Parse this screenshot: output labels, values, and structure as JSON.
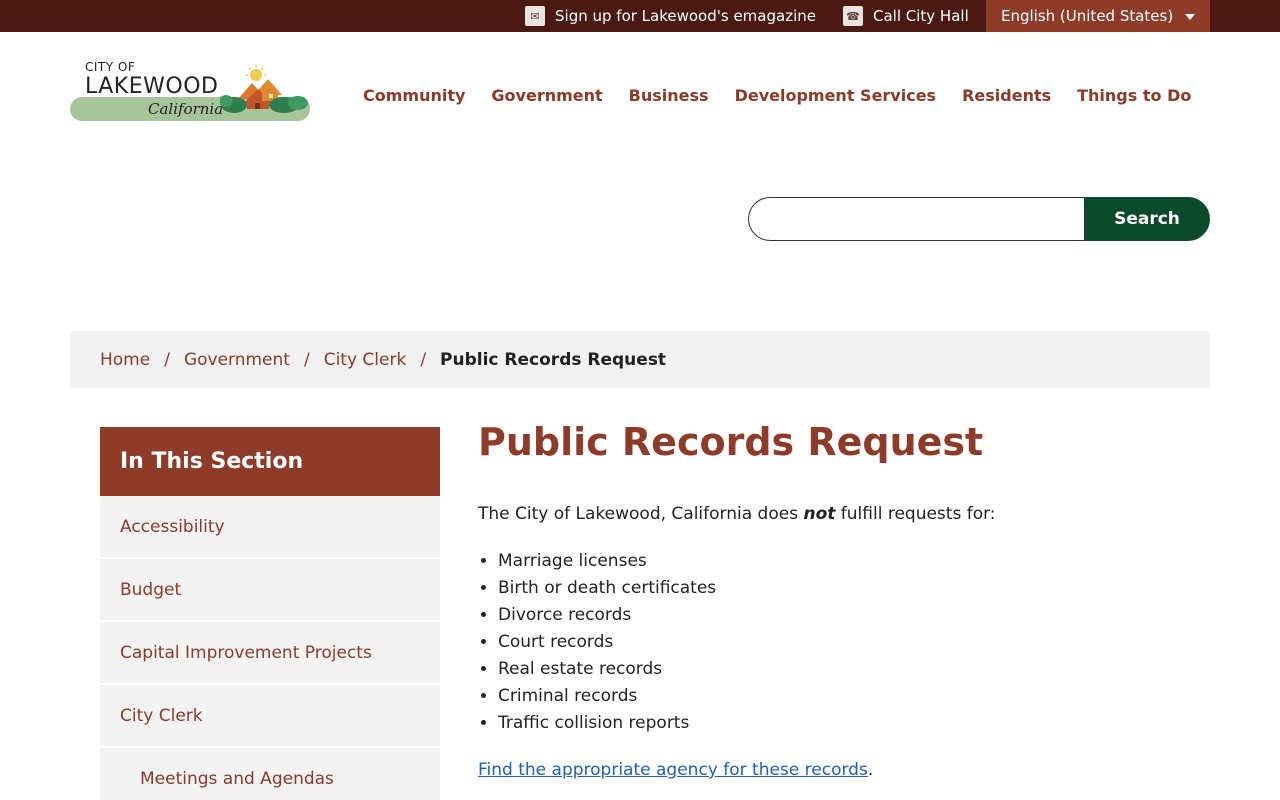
{
  "topbar": {
    "emagazine_label": "Sign up for Lakewood's emagazine",
    "call_label": "Call City Hall",
    "language_label": "English (United States)"
  },
  "logo": {
    "line1": "CITY OF",
    "line2": "LAKEWOOD",
    "line3": "California"
  },
  "nav": {
    "items": [
      "Community",
      "Government",
      "Business",
      "Development Services",
      "Residents",
      "Things to Do"
    ]
  },
  "search": {
    "value": "",
    "button_label": "Search"
  },
  "breadcrumb": {
    "items": [
      "Home",
      "Government",
      "City Clerk"
    ],
    "separator": "/",
    "current": "Public Records Request"
  },
  "sidebar": {
    "heading": "In This Section",
    "items": [
      "Accessibility",
      "Budget",
      "Capital Improvement Projects",
      "City Clerk"
    ],
    "subitems": [
      "Meetings and Agendas"
    ]
  },
  "content": {
    "title": "Public Records Request",
    "intro_before": "The City of Lakewood, California does ",
    "intro_emphasis": "not",
    "intro_after": " fulfill requests for:",
    "records": [
      "Marriage licenses",
      "Birth or death certificates",
      "Divorce records",
      "Court records",
      "Real estate records",
      "Criminal records",
      "Traffic collision reports"
    ],
    "agency_link": "Find the appropriate agency for these records",
    "agency_after": "."
  },
  "colors": {
    "topbar_bg": "#4a1a12",
    "brand_red": "#8f3b2a",
    "search_green": "#0c4a2c",
    "link_blue": "#1f5fbf"
  },
  "icons": [
    "mail-icon",
    "phone-icon",
    "caret-down-icon",
    "logo-houses-icon"
  ]
}
